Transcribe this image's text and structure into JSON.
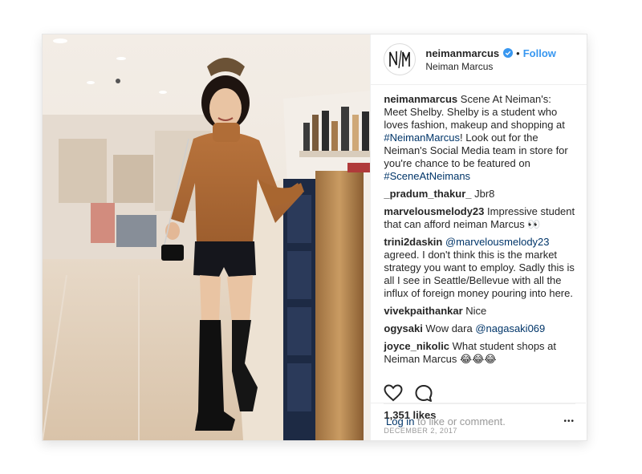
{
  "account": {
    "username": "neimanmarcus",
    "display_name": "Neiman Marcus",
    "follow_label": "Follow",
    "dot": "•",
    "avatar_text": "N/M"
  },
  "comments": [
    {
      "user": "neimanmarcus",
      "parts": [
        {
          "t": " Scene At Neiman's: Meet Shelby. Shelby is a student who loves fashion, makeup and shopping at "
        },
        {
          "t": "#NeimanMarcus",
          "link": true
        },
        {
          "t": "! Look out for the Neiman's Social Media team in store for you're chance to be featured on "
        },
        {
          "t": "#SceneAtNeimans",
          "link": true
        }
      ]
    },
    {
      "user": "_pradum_thakur_",
      "parts": [
        {
          "t": " Jbr8"
        }
      ]
    },
    {
      "user": "marvelousmelody23",
      "parts": [
        {
          "t": " Impressive student that can afford neiman Marcus 👀"
        }
      ]
    },
    {
      "user": "trini2daskin",
      "parts": [
        {
          "t": " "
        },
        {
          "t": "@marvelousmelody23",
          "link": true
        },
        {
          "t": " agreed. I don't think this is the market strategy you want to employ. Sadly this is all I see in Seattle/Bellevue with all the influx of foreign money pouring into here."
        }
      ]
    },
    {
      "user": "vivekpaithankar",
      "parts": [
        {
          "t": " Nice"
        }
      ]
    },
    {
      "user": "ogysaki",
      "parts": [
        {
          "t": " Wow dara "
        },
        {
          "t": "@nagasaki069",
          "link": true
        }
      ]
    },
    {
      "user": "joyce_nikolic",
      "parts": [
        {
          "t": " What student shops at Neiman Marcus 😂😂😂"
        }
      ]
    }
  ],
  "post": {
    "likes": "1,351 likes",
    "date": "DECEMBER 2, 2017",
    "login_link": "Log in",
    "login_rest": " to like or comment.",
    "more": "•••"
  },
  "colors": {
    "link": "#003569",
    "follow": "#3897f0",
    "verified": "#3897f0"
  },
  "icons": {
    "like": "heart-icon",
    "comment": "comment-icon",
    "verified": "verified-badge-icon",
    "more": "more-options-icon"
  }
}
